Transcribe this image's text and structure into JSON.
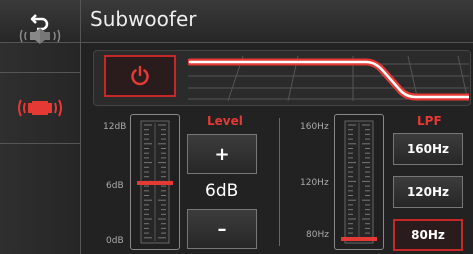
{
  "header": {
    "title": "Subwoofer",
    "back_icon": "back-arrow-icon"
  },
  "sidebar": {
    "items": [
      {
        "icon": "speakers-icon",
        "selected": false
      },
      {
        "icon": "subwoofer-icon",
        "selected": true
      }
    ]
  },
  "power": {
    "icon": "power-icon",
    "on": true
  },
  "colors": {
    "accent": "#e53935"
  },
  "level": {
    "title": "Level",
    "scale_labels": [
      "12dB",
      "6dB",
      "0dB"
    ],
    "value": "6dB",
    "increase": "+",
    "decrease": "–",
    "fraction": 0.5
  },
  "lpf": {
    "title": "LPF",
    "scale_labels": [
      "160Hz",
      "120Hz",
      "80Hz"
    ],
    "options": [
      "160Hz",
      "120Hz",
      "80Hz"
    ],
    "selected": "80Hz",
    "fraction": 0.0
  }
}
